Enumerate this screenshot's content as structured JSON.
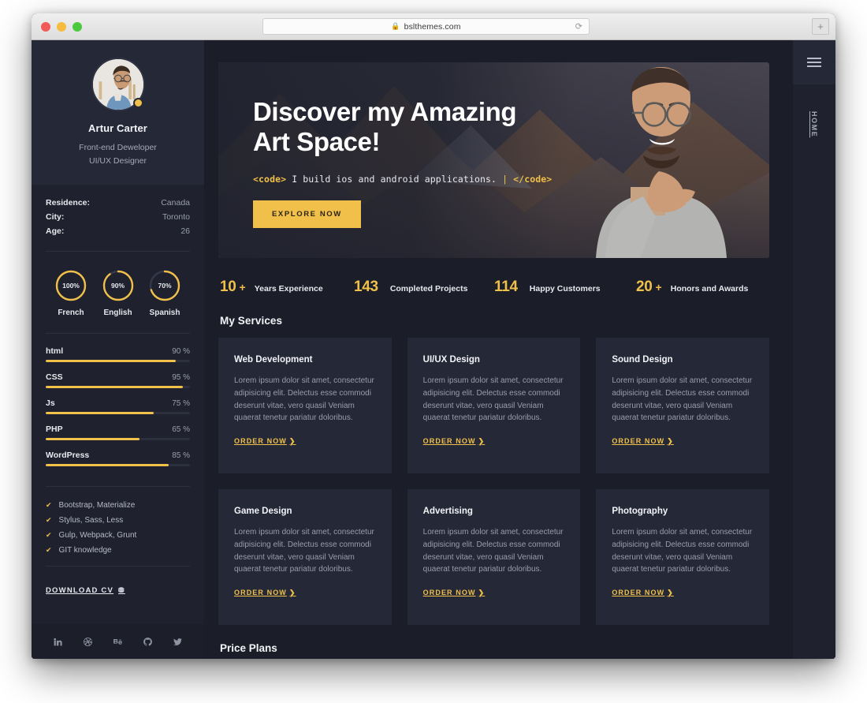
{
  "browser": {
    "url": "bslthemes.com",
    "lock_icon": "lock-icon",
    "reload_icon": "reload-icon",
    "newtab_label": "+"
  },
  "sidebar": {
    "name": "Artur Carter",
    "role_line1": "Front-end Deweloper",
    "role_line2": "UI/UX Designer",
    "facts": [
      {
        "key": "Residence:",
        "value": "Canada"
      },
      {
        "key": "City:",
        "value": "Toronto"
      },
      {
        "key": "Age:",
        "value": "26"
      }
    ],
    "languages": [
      {
        "name": "French",
        "percent": 100,
        "label": "100%"
      },
      {
        "name": "English",
        "percent": 90,
        "label": "90%"
      },
      {
        "name": "Spanish",
        "percent": 70,
        "label": "70%"
      }
    ],
    "skills": [
      {
        "name": "html",
        "percent": 90,
        "label": "90 %"
      },
      {
        "name": "CSS",
        "percent": 95,
        "label": "95 %"
      },
      {
        "name": "Js",
        "percent": 75,
        "label": "75 %"
      },
      {
        "name": "PHP",
        "percent": 65,
        "label": "65 %"
      },
      {
        "name": "WordPress",
        "percent": 85,
        "label": "85 %"
      }
    ],
    "knowledge": [
      "Bootstrap, Materialize",
      "Stylus, Sass, Less",
      "Gulp, Webpack, Grunt",
      "GIT knowledge"
    ],
    "download_cv": "DOWNLOAD CV",
    "social": [
      "linkedin-icon",
      "dribbble-icon",
      "behance-icon",
      "github-icon",
      "twitter-icon"
    ]
  },
  "hero": {
    "title_line1": "Discover my Amazing",
    "title_line2": "Art Space!",
    "code_open": "<code>",
    "code_text": "I build ios and android applications.",
    "code_close": "</code>",
    "button": "EXPLORE NOW"
  },
  "stats": [
    {
      "number": "10",
      "plus": "+",
      "label": "Years Experience"
    },
    {
      "number": "143",
      "plus": "",
      "label": "Completed Projects"
    },
    {
      "number": "114",
      "plus": "",
      "label": "Happy Customers"
    },
    {
      "number": "20",
      "plus": "+",
      "label": "Honors and Awards"
    }
  ],
  "services": {
    "title": "My Services",
    "order_label": "ORDER NOW",
    "body": "Lorem ipsum dolor sit amet, consectetur adipisicing elit. Delectus esse commodi deserunt vitae, vero quasil Veniam quaerat tenetur pariatur doloribus.",
    "cards": [
      {
        "title": "Web Development"
      },
      {
        "title": "UI/UX Design"
      },
      {
        "title": "Sound Design"
      },
      {
        "title": "Game Design"
      },
      {
        "title": "Advertising"
      },
      {
        "title": "Photography"
      }
    ]
  },
  "next_section": {
    "title": "Price Plans"
  },
  "rail": {
    "menu_icon": "hamburger-menu-icon",
    "items": [
      {
        "label": "HOME"
      }
    ]
  },
  "colors": {
    "accent": "#f0c04a",
    "page_bg": "#1b1e29",
    "panel_bg": "#252837",
    "sidebar_bg": "#1f222e",
    "text": "#f2f3f7",
    "muted": "#9a9daa"
  }
}
